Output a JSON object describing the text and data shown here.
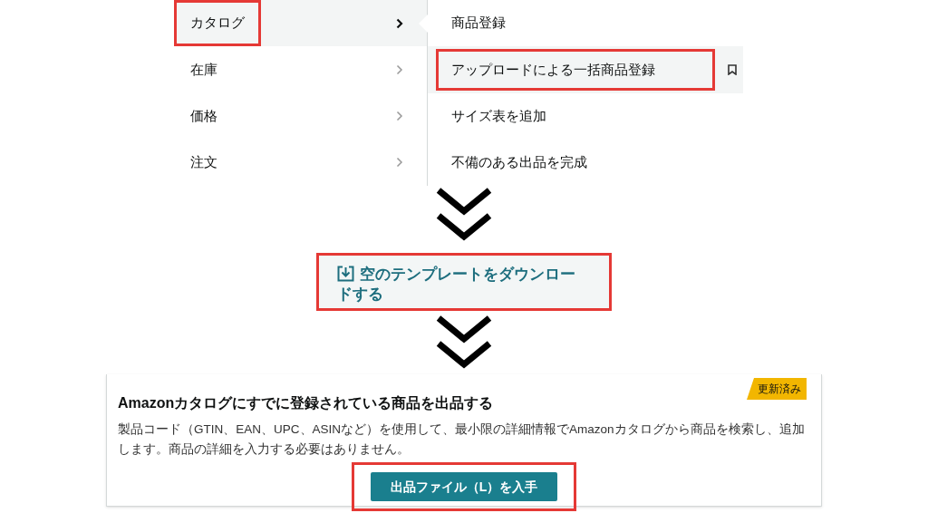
{
  "menu": {
    "categories": [
      {
        "label": "カタログ",
        "selected": true,
        "highlighted": true
      },
      {
        "label": "在庫",
        "selected": false,
        "highlighted": false
      },
      {
        "label": "価格",
        "selected": false,
        "highlighted": false
      },
      {
        "label": "注文",
        "selected": false,
        "highlighted": false
      }
    ],
    "submenu": [
      {
        "label": "商品登録",
        "hovered": false,
        "highlighted": false
      },
      {
        "label": "アップロードによる一括商品登録",
        "hovered": true,
        "highlighted": true
      },
      {
        "label": "サイズ表を追加",
        "hovered": false,
        "highlighted": false
      },
      {
        "label": "不備のある出品を完成",
        "hovered": false,
        "highlighted": false
      }
    ]
  },
  "download_link": {
    "label": "空のテンプレートをダウンロードする",
    "highlighted": true
  },
  "card": {
    "title": "Amazonカタログにすでに登録されている商品を出品する",
    "badge": "更新済み",
    "description": "製品コード（GTIN、EAN、UPC、ASINなど）を使用して、最小限の詳細情報でAmazonカタログから商品を検索し、追加します。商品の詳細を入力する必要はありません。",
    "button": {
      "label": "出品ファイル（L）を入手",
      "highlighted": true
    }
  }
}
